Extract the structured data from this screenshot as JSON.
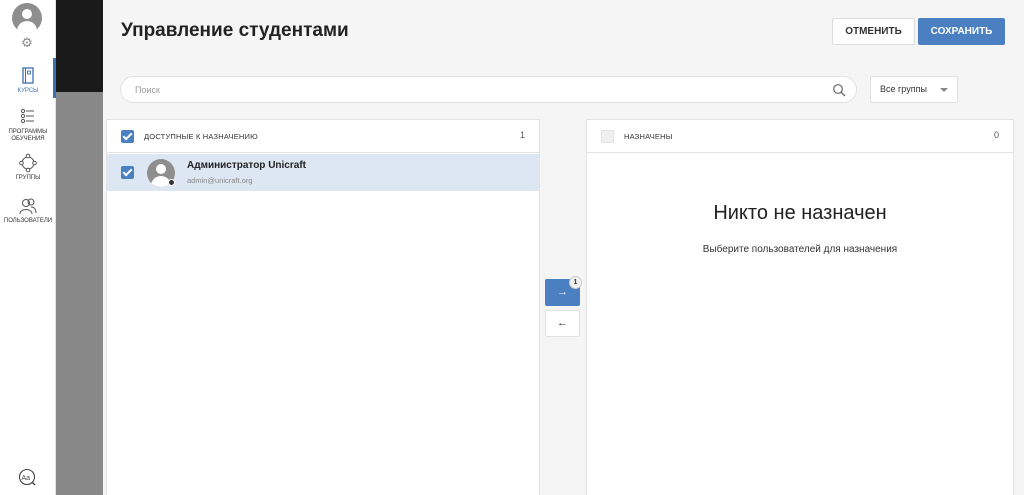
{
  "sidebar": {
    "items": [
      {
        "label": "КУРСЫ"
      },
      {
        "label": "ПРОГРАММЫ ОБУЧЕНИЯ"
      },
      {
        "label": "ГРУППЫ"
      },
      {
        "label": "ПОЛЬЗОВАТЕЛИ"
      }
    ],
    "accent_color": "#3a6fb5"
  },
  "header": {
    "title": "Управление студентами",
    "cancel_label": "ОТМЕНИТЬ",
    "save_label": "СОХРАНИТЬ"
  },
  "search": {
    "placeholder": "Поиск",
    "value": ""
  },
  "groups_filter": {
    "selected": "Все группы"
  },
  "available": {
    "header_label": "ДОСТУПНЫЕ К НАЗНАЧЕНИЮ",
    "count": "1",
    "users": [
      {
        "name": "Администратор Unicraft",
        "email": "admin@unicraft.org"
      }
    ]
  },
  "move": {
    "right_arrow": "→",
    "left_arrow": "←",
    "selected_badge": "1"
  },
  "assigned": {
    "header_label": "НАЗНАЧЕНЫ",
    "count": "0",
    "empty_title": "Никто не назначен",
    "empty_subtitle": "Выберите пользователей для назначения"
  },
  "colors": {
    "primary": "#4a7fc1",
    "selected_row": "#dde7f4"
  }
}
